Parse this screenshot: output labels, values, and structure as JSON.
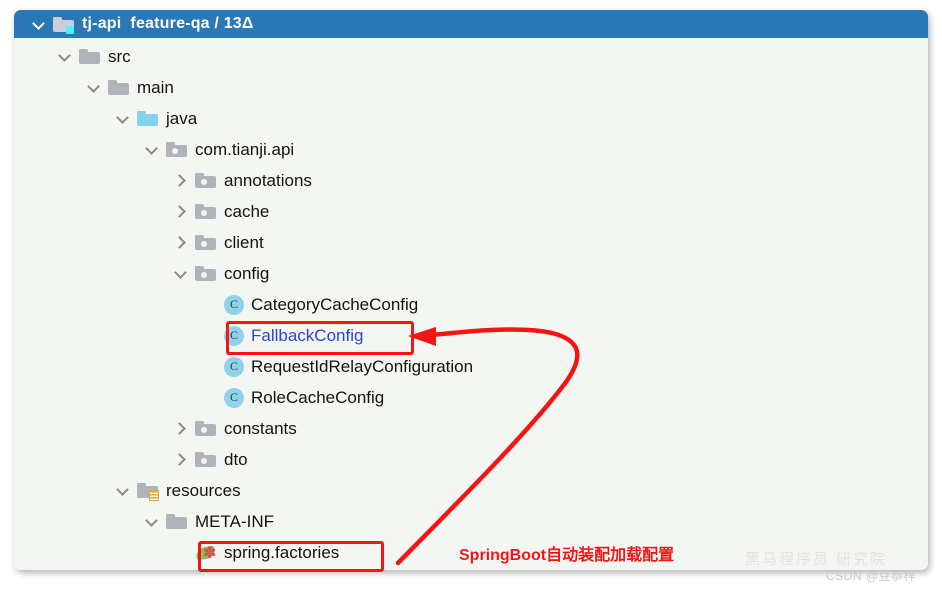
{
  "header": {
    "module_name": "tj-api",
    "branch_info": "feature-qa / 13Δ",
    "expand_icon": "chevron-down-icon",
    "folder_icon": "module-folder-icon",
    "background_color": "#2a78b8"
  },
  "tree": {
    "items": [
      {
        "label": "src",
        "kind": "folder",
        "chevron": "down",
        "depth": 1,
        "icon": "folder-icon"
      },
      {
        "label": "main",
        "kind": "folder",
        "chevron": "down",
        "depth": 2,
        "icon": "folder-icon"
      },
      {
        "label": "java",
        "kind": "source",
        "chevron": "down",
        "depth": 3,
        "icon": "source-root-folder-icon"
      },
      {
        "label": "com.tianji.api",
        "kind": "package",
        "chevron": "down",
        "depth": 4,
        "icon": "package-folder-icon"
      },
      {
        "label": "annotations",
        "kind": "package",
        "chevron": "right",
        "depth": 5,
        "icon": "package-folder-icon"
      },
      {
        "label": "cache",
        "kind": "package",
        "chevron": "right",
        "depth": 5,
        "icon": "package-folder-icon"
      },
      {
        "label": "client",
        "kind": "package",
        "chevron": "right",
        "depth": 5,
        "icon": "package-folder-icon"
      },
      {
        "label": "config",
        "kind": "package",
        "chevron": "down",
        "depth": 5,
        "icon": "package-folder-icon"
      },
      {
        "label": "CategoryCacheConfig",
        "kind": "class",
        "chevron": "none",
        "depth": 6,
        "icon": "java-class-icon"
      },
      {
        "label": "FallbackConfig",
        "kind": "class",
        "chevron": "none",
        "depth": 6,
        "icon": "java-class-icon",
        "highlighted": true
      },
      {
        "label": "RequestIdRelayConfiguration",
        "kind": "class",
        "chevron": "none",
        "depth": 6,
        "icon": "java-class-icon"
      },
      {
        "label": "RoleCacheConfig",
        "kind": "class",
        "chevron": "none",
        "depth": 6,
        "icon": "java-class-icon"
      },
      {
        "label": "constants",
        "kind": "package",
        "chevron": "right",
        "depth": 5,
        "icon": "package-folder-icon"
      },
      {
        "label": "dto",
        "kind": "package",
        "chevron": "right",
        "depth": 5,
        "icon": "package-folder-icon"
      },
      {
        "label": "resources",
        "kind": "resources",
        "chevron": "down",
        "depth": 3,
        "icon": "resources-folder-icon"
      },
      {
        "label": "META-INF",
        "kind": "folder",
        "chevron": "down",
        "depth": 4,
        "icon": "folder-icon"
      },
      {
        "label": "spring.factories",
        "kind": "spring",
        "chevron": "none",
        "depth": 5,
        "icon": "spring-leaf-icon"
      }
    ],
    "class_icon_letter": "C",
    "spring_star_glyph": "✽"
  },
  "annotations": {
    "highlight_color": "#f41414",
    "spring_label": "SpringBoot自动装配加载配置",
    "arrow_name": "curved-arrow-spring-to-fallback"
  },
  "watermark": {
    "brand": "黑马程序员 研究院",
    "author": "CSDN @豆恭梓"
  }
}
